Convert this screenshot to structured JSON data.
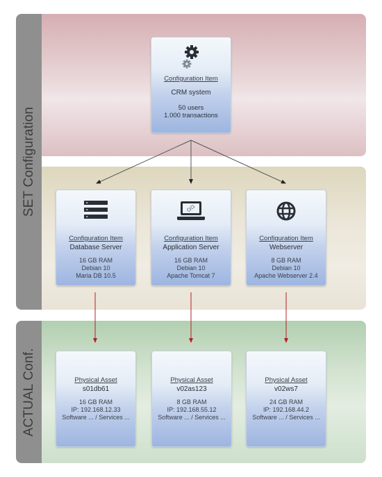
{
  "sections": {
    "set_label": "SET Configuration",
    "actual_label": "ACTUAL Conf."
  },
  "colors": {
    "sidebar": "#8f8f8f",
    "set_arrow": "#333333",
    "actual_arrow": "#b0202a",
    "card_gradient_end": "#9db5e0"
  },
  "top_item": {
    "icon": "gears-icon",
    "type": "Configuration Item",
    "name": "CRM system",
    "attrs": [
      "50 users",
      "1.000 transactions"
    ]
  },
  "config_items": [
    {
      "icon": "server-rack-icon",
      "type": "Configuration Item",
      "name": "Database Server",
      "attrs": [
        "16 GB RAM",
        "Debian 10",
        "Maria DB 10.5"
      ]
    },
    {
      "icon": "laptop-gears-icon",
      "type": "Configuration Item",
      "name": "Application Server",
      "attrs": [
        "16 GB RAM",
        "Debian 10",
        "Apache Tomcat 7"
      ]
    },
    {
      "icon": "globe-icon",
      "type": "Configuration Item",
      "name": "Webserver",
      "attrs": [
        "8 GB RAM",
        "Debian 10",
        "Apache Webserver 2.4"
      ]
    }
  ],
  "physical_assets": [
    {
      "type": "Physical Asset",
      "name": "s01db61",
      "attrs": [
        "16 GB RAM",
        "IP: 192.168.12.33",
        "Software ... / Services ..."
      ]
    },
    {
      "type": "Physical Asset",
      "name": "v02as123",
      "attrs": [
        "8 GB RAM",
        "IP: 192.168.55.12",
        "Software ... / Services ..."
      ]
    },
    {
      "type": "Physical Asset",
      "name": "v02ws7",
      "attrs": [
        "24 GB RAM",
        "IP: 192.168.44.2",
        "Software ... / Services ..."
      ]
    }
  ]
}
